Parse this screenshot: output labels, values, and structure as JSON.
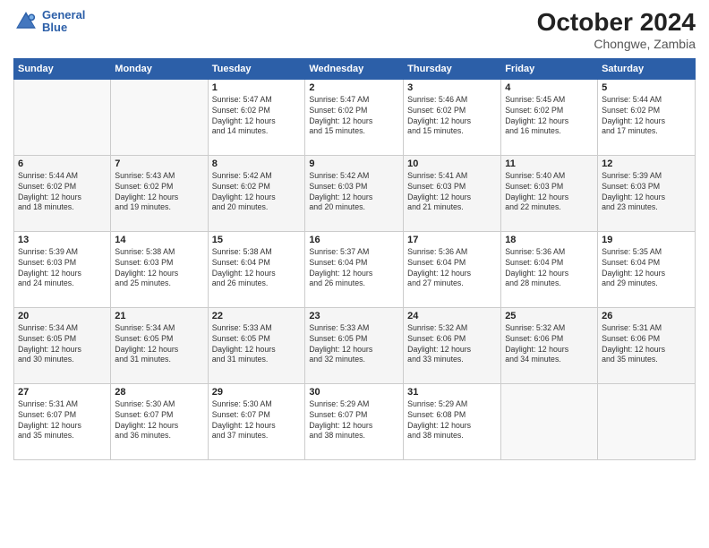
{
  "logo": {
    "line1": "General",
    "line2": "Blue"
  },
  "title": "October 2024",
  "subtitle": "Chongwe, Zambia",
  "headers": [
    "Sunday",
    "Monday",
    "Tuesday",
    "Wednesday",
    "Thursday",
    "Friday",
    "Saturday"
  ],
  "weeks": [
    [
      {
        "day": "",
        "info": ""
      },
      {
        "day": "",
        "info": ""
      },
      {
        "day": "1",
        "info": "Sunrise: 5:47 AM\nSunset: 6:02 PM\nDaylight: 12 hours\nand 14 minutes."
      },
      {
        "day": "2",
        "info": "Sunrise: 5:47 AM\nSunset: 6:02 PM\nDaylight: 12 hours\nand 15 minutes."
      },
      {
        "day": "3",
        "info": "Sunrise: 5:46 AM\nSunset: 6:02 PM\nDaylight: 12 hours\nand 15 minutes."
      },
      {
        "day": "4",
        "info": "Sunrise: 5:45 AM\nSunset: 6:02 PM\nDaylight: 12 hours\nand 16 minutes."
      },
      {
        "day": "5",
        "info": "Sunrise: 5:44 AM\nSunset: 6:02 PM\nDaylight: 12 hours\nand 17 minutes."
      }
    ],
    [
      {
        "day": "6",
        "info": "Sunrise: 5:44 AM\nSunset: 6:02 PM\nDaylight: 12 hours\nand 18 minutes."
      },
      {
        "day": "7",
        "info": "Sunrise: 5:43 AM\nSunset: 6:02 PM\nDaylight: 12 hours\nand 19 minutes."
      },
      {
        "day": "8",
        "info": "Sunrise: 5:42 AM\nSunset: 6:02 PM\nDaylight: 12 hours\nand 20 minutes."
      },
      {
        "day": "9",
        "info": "Sunrise: 5:42 AM\nSunset: 6:03 PM\nDaylight: 12 hours\nand 20 minutes."
      },
      {
        "day": "10",
        "info": "Sunrise: 5:41 AM\nSunset: 6:03 PM\nDaylight: 12 hours\nand 21 minutes."
      },
      {
        "day": "11",
        "info": "Sunrise: 5:40 AM\nSunset: 6:03 PM\nDaylight: 12 hours\nand 22 minutes."
      },
      {
        "day": "12",
        "info": "Sunrise: 5:39 AM\nSunset: 6:03 PM\nDaylight: 12 hours\nand 23 minutes."
      }
    ],
    [
      {
        "day": "13",
        "info": "Sunrise: 5:39 AM\nSunset: 6:03 PM\nDaylight: 12 hours\nand 24 minutes."
      },
      {
        "day": "14",
        "info": "Sunrise: 5:38 AM\nSunset: 6:03 PM\nDaylight: 12 hours\nand 25 minutes."
      },
      {
        "day": "15",
        "info": "Sunrise: 5:38 AM\nSunset: 6:04 PM\nDaylight: 12 hours\nand 26 minutes."
      },
      {
        "day": "16",
        "info": "Sunrise: 5:37 AM\nSunset: 6:04 PM\nDaylight: 12 hours\nand 26 minutes."
      },
      {
        "day": "17",
        "info": "Sunrise: 5:36 AM\nSunset: 6:04 PM\nDaylight: 12 hours\nand 27 minutes."
      },
      {
        "day": "18",
        "info": "Sunrise: 5:36 AM\nSunset: 6:04 PM\nDaylight: 12 hours\nand 28 minutes."
      },
      {
        "day": "19",
        "info": "Sunrise: 5:35 AM\nSunset: 6:04 PM\nDaylight: 12 hours\nand 29 minutes."
      }
    ],
    [
      {
        "day": "20",
        "info": "Sunrise: 5:34 AM\nSunset: 6:05 PM\nDaylight: 12 hours\nand 30 minutes."
      },
      {
        "day": "21",
        "info": "Sunrise: 5:34 AM\nSunset: 6:05 PM\nDaylight: 12 hours\nand 31 minutes."
      },
      {
        "day": "22",
        "info": "Sunrise: 5:33 AM\nSunset: 6:05 PM\nDaylight: 12 hours\nand 31 minutes."
      },
      {
        "day": "23",
        "info": "Sunrise: 5:33 AM\nSunset: 6:05 PM\nDaylight: 12 hours\nand 32 minutes."
      },
      {
        "day": "24",
        "info": "Sunrise: 5:32 AM\nSunset: 6:06 PM\nDaylight: 12 hours\nand 33 minutes."
      },
      {
        "day": "25",
        "info": "Sunrise: 5:32 AM\nSunset: 6:06 PM\nDaylight: 12 hours\nand 34 minutes."
      },
      {
        "day": "26",
        "info": "Sunrise: 5:31 AM\nSunset: 6:06 PM\nDaylight: 12 hours\nand 35 minutes."
      }
    ],
    [
      {
        "day": "27",
        "info": "Sunrise: 5:31 AM\nSunset: 6:07 PM\nDaylight: 12 hours\nand 35 minutes."
      },
      {
        "day": "28",
        "info": "Sunrise: 5:30 AM\nSunset: 6:07 PM\nDaylight: 12 hours\nand 36 minutes."
      },
      {
        "day": "29",
        "info": "Sunrise: 5:30 AM\nSunset: 6:07 PM\nDaylight: 12 hours\nand 37 minutes."
      },
      {
        "day": "30",
        "info": "Sunrise: 5:29 AM\nSunset: 6:07 PM\nDaylight: 12 hours\nand 38 minutes."
      },
      {
        "day": "31",
        "info": "Sunrise: 5:29 AM\nSunset: 6:08 PM\nDaylight: 12 hours\nand 38 minutes."
      },
      {
        "day": "",
        "info": ""
      },
      {
        "day": "",
        "info": ""
      }
    ]
  ]
}
